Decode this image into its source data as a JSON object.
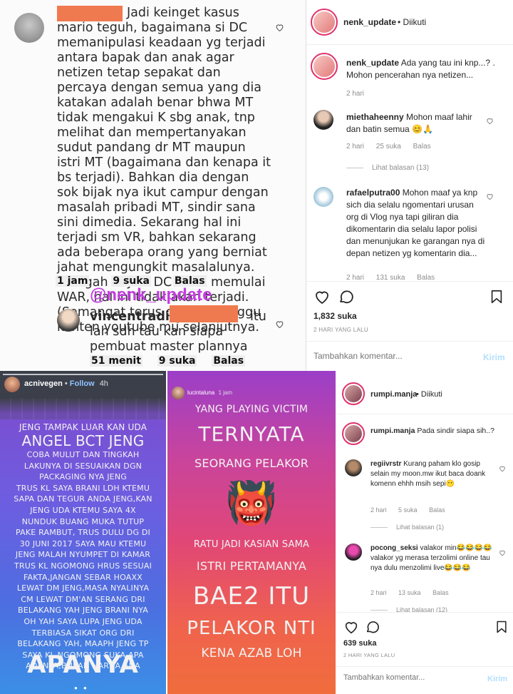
{
  "top_left": {
    "main_comment": "Jadi keinget kasus mario teguh, bagaimana si DC memanipulasi keadaan yg terjadi antara  bapak dan anak agar netizen tetap sepakat dan percaya dengan semua yang dia katakan adalah benar bhwa MT tidak mengakui K sbg anak, tnp melihat dan mempertanyakan sudut pandang dr MT maupun istri MT (bagaimana dan kenapa it bs terjadi). Bahkan dia dengan sok bijak nya ikut campur dengan masalah pribadi MT, sindir sana sini dimedia. Sekarang hal ini terjadi sm VR, bahkan sekarang ada beberapa orang yang berniat jahat mengungkit masalalunya. Astagah ... Jika DC tidak memulai WAR, hal ini tidak akan terjadi. (Semangat terus capt) kutunggu konten youtube mu selanjutnya.",
    "main_meta": {
      "time": "1 jam",
      "likes": "9 suka",
      "reply": "Balas"
    },
    "watermark": "@nenk_update",
    "reply_username": "vincentraditya",
    "reply_text": "itu lah sdh tau kan siapa pembuat master plannya",
    "reply_meta": {
      "time": "51 menit",
      "likes": "9 suka",
      "reply": "Balas"
    }
  },
  "top_right": {
    "header_user": "nenk_update",
    "header_follow": "• Diikuti",
    "caption_user": "nenk_update",
    "caption_text": "Ada yang tau ini knp...? . Mohon pencerahan nya netizen...",
    "caption_time": "2 hari",
    "comments": [
      {
        "user": "miethaheenny",
        "text": "Mohon maaf lahir dan batin semua 😊🙏",
        "time": "2 hari",
        "likes": "25 suka",
        "reply": "Balas",
        "view_replies": "Lihat balasan (13)"
      },
      {
        "user": "rafaelputra00",
        "text": "Mohon maaf ya knp sich dia selalu ngomentari urusan org di Vlog nya tapi giliran dia dikomentarin dia selalu lapor polisi dan menunjukan ke garangan nya di depan netizen yg komentarin dia...",
        "time": "2 hari",
        "likes": "131 suka",
        "reply": "Balas"
      }
    ],
    "likes": "1,832 suka",
    "date": "2 HARI YANG LALU",
    "input_placeholder": "Tambahkan komentar...",
    "post_label": "Kirim"
  },
  "story1": {
    "username": "acnivegen",
    "follow": "Follow",
    "time": "4h",
    "line_big": "ANGEL BCT JENG",
    "line_top": "JENG TAMPAK LUAR KAN UDA",
    "body": "COBA MULUT DAN TINGKAH\nLAKUNYA DI SESUAIKAN DGN\nPACKAGING NYA JENG\nTRUS KL SAYA BRANI LDH KTEMU\nSAPA DAN TEGUR ANDA JENG,KAN\nJENG UDA KTEMU SAYA 4X\nNUNDUK BUANG MUKA TUTUP\nPAKE RAMBUT, TRUS DULU DG DI\n30 JUNI 2017 SAYA MAU KTEMU\nJENG MALAH NYUMPET DI KAMAR\nTRUS KL NGOMONG HRUS SESUAI\nFAKTA,JANGAN SEBAR HOAXX\nLEWAT DM JENG,MASA NYALINYA\nCM LEWAT DM'AN SERANG DRI\nBELAKANG YAH JENG BRANI NYA\nOH YAH SAYA LUPA JENG UDA\nTERBIASA SIKAT ORG DRI\nBELAKANG YAH, MAAPH JENG TP\nSAYA KL NGOMONG SUKA APA\nADANYA,BUKAN HARNA ADA",
    "last": "APANYA"
  },
  "story2": {
    "username": "lucintaluna",
    "time": "1 jam",
    "l1": "YANG PLAYING VICTIM",
    "l2": "TERNYATA",
    "l3": "SEORANG PELAKOR",
    "emoji": "👹",
    "l4": "RATU JADI KASIAN SAMA",
    "l5": "ISTRI PERTAMANYA",
    "l6": "BAE2 ITU",
    "l7": "PELAKOR NTI",
    "l8": "KENA AZAB LOH"
  },
  "bottom_right": {
    "header_user": "rumpi.manja",
    "header_follow": "• Diikuti",
    "caption_user": "rumpi.manja",
    "caption_text": "Pada sindir siapa sih..?",
    "comments": [
      {
        "user": "regiivrstr",
        "text": "Kurang paham klo gosip selain my moon.mw ikut baca doank komenn ehhh msih sepi😶",
        "time": "2 hari",
        "likes": "5 suka",
        "reply": "Balas",
        "view_replies": "Lihat balasan (1)"
      },
      {
        "user": "pocong_seksi",
        "text": "valakor min😂😂😂😂valakor yg merasa terzolimi online tau nya dulu menzolimi live😂😂😂",
        "time": "2 hari",
        "likes": "13 suka",
        "reply": "Balas",
        "view_replies": "Lihat balasan (12)"
      }
    ],
    "likes": "639 suka",
    "date": "2 HARI YANG LALU",
    "input_placeholder": "Tambahkan komentar...",
    "post_label": "Kirim"
  }
}
